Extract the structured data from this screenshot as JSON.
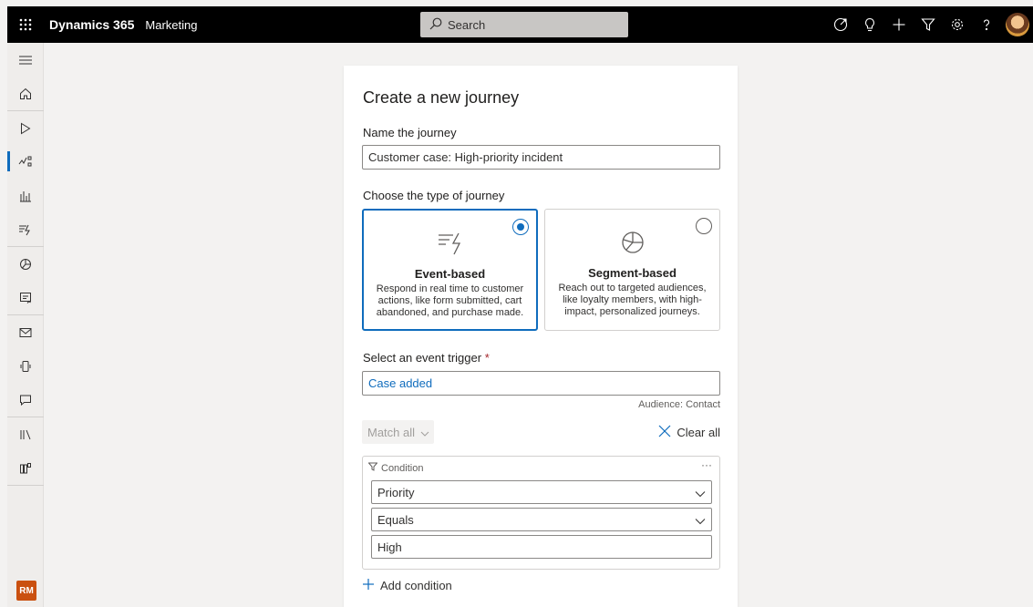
{
  "app": {
    "name": "Dynamics 365",
    "module": "Marketing"
  },
  "search": {
    "label": "Search"
  },
  "topbar_icons": [
    "target-icon",
    "lightbulb-icon",
    "plus-icon",
    "filter-icon",
    "gear-icon",
    "help-icon"
  ],
  "leftnav": {
    "items": [
      "hamburger-icon",
      "home-icon",
      "play-icon",
      "journeys-icon",
      "analytics-icon",
      "triggers-icon",
      "segments-icon",
      "forms-icon",
      "email-icon",
      "push-icon",
      "sms-icon",
      "library-icon",
      "assets-icon"
    ],
    "active": "journeys-icon",
    "user_initials": "RM"
  },
  "form": {
    "title": "Create a new journey",
    "name_label": "Name the journey",
    "name_value": "Customer case: High-priority incident",
    "type_label": "Choose the type of journey",
    "tiles": [
      {
        "title": "Event-based",
        "desc": "Respond in real time to customer actions, like form submitted, cart abandoned, and purchase made.",
        "selected": true
      },
      {
        "title": "Segment-based",
        "desc": "Reach out to targeted audiences, like loyalty members, with high-impact, personalized journeys.",
        "selected": false
      }
    ],
    "trigger_label": "Select an event trigger",
    "required_mark": "*",
    "trigger_value": "Case added",
    "audience": "Audience: Contact",
    "match_label": "Match all",
    "clear_all": "Clear all",
    "condition": {
      "header": "Condition",
      "more": "···",
      "attribute": "Priority",
      "operator": "Equals",
      "value": "High"
    },
    "add_condition": "Add condition"
  },
  "colors": {
    "accent": "#0f6cbd",
    "topbar": "#000000",
    "required": "#a4262c",
    "badge": "#ca5010"
  }
}
